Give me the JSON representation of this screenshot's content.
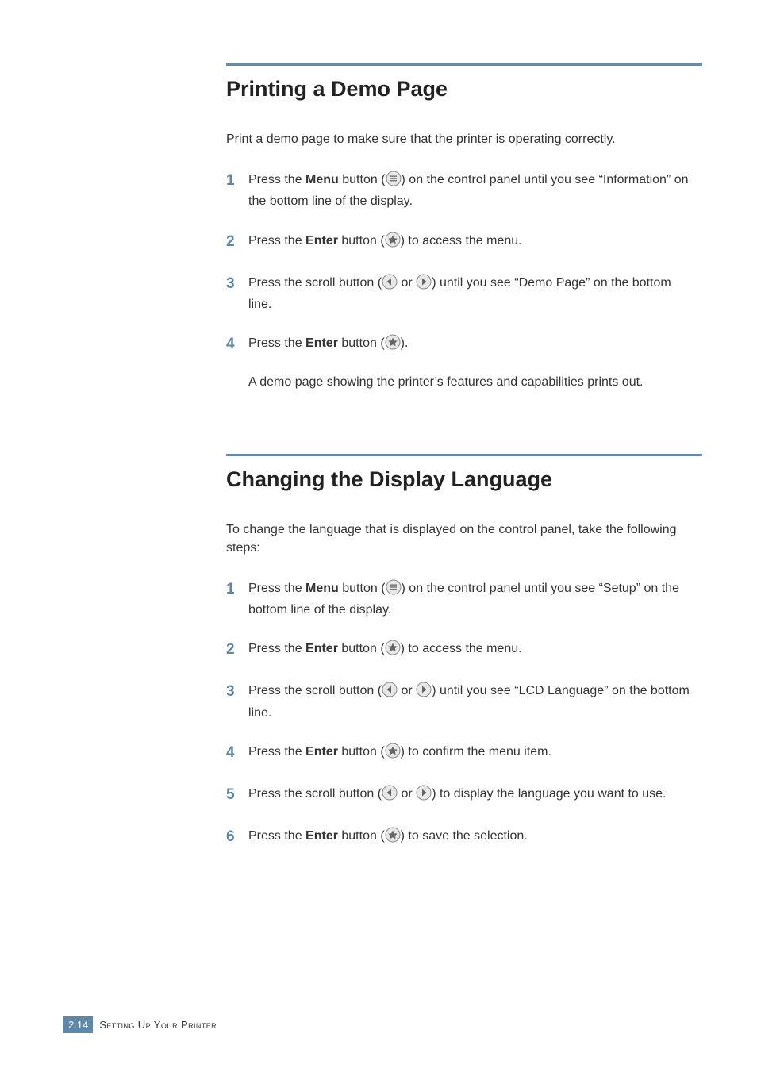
{
  "section1": {
    "title": "Printing a Demo Page",
    "intro": "Print a demo page to make sure that the printer is operating correctly.",
    "steps": {
      "s1": {
        "num": "1",
        "pre": "Press the ",
        "bold": "Menu",
        "mid": " button (",
        "post": ") on the control panel until you see “Information” on the bottom line of the display."
      },
      "s2": {
        "num": "2",
        "pre": "Press the ",
        "bold": "Enter",
        "mid": " button (",
        "post": ") to access the menu."
      },
      "s3": {
        "num": "3",
        "pre": "Press the scroll button (",
        "or": " or ",
        "post": ") until you see “Demo Page” on the bottom line."
      },
      "s4": {
        "num": "4",
        "pre": "Press the ",
        "bold": "Enter",
        "mid": " button (",
        "post": ").",
        "follow": "A demo page showing the printer’s features and capabilities prints out."
      }
    }
  },
  "section2": {
    "title": "Changing the Display Language",
    "intro": "To change the language that is displayed on the control panel, take the following steps:",
    "steps": {
      "s1": {
        "num": "1",
        "pre": "Press the ",
        "bold": "Menu",
        "mid": " button (",
        "post": ") on the control panel until you see “Setup” on the bottom line of the display."
      },
      "s2": {
        "num": "2",
        "pre": "Press the ",
        "bold": "Enter",
        "mid": " button (",
        "post": ") to access the menu."
      },
      "s3": {
        "num": "3",
        "pre": "Press the scroll button (",
        "or": " or ",
        "post": ") until you see “LCD Language” on the bottom line."
      },
      "s4": {
        "num": "4",
        "pre": "Press the ",
        "bold": "Enter",
        "mid": " button (",
        "post": ") to confirm the menu item."
      },
      "s5": {
        "num": "5",
        "pre": "Press the scroll button (",
        "or": " or ",
        "post": ") to display the language you want to use."
      },
      "s6": {
        "num": "6",
        "pre": "Press the ",
        "bold": "Enter",
        "mid": " button (",
        "post": ") to save the selection."
      }
    }
  },
  "footer": {
    "badge_chapter": "2.",
    "badge_page": "14",
    "text": "Setting Up Your Printer"
  }
}
